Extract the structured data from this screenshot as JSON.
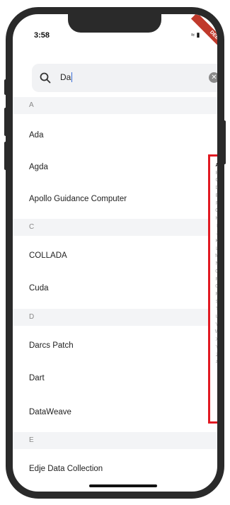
{
  "status": {
    "time": "3:58",
    "debug_label": "DEBUG"
  },
  "search": {
    "value": "Da",
    "clear_icon": "clear-icon",
    "icon": "search-icon"
  },
  "sections": [
    {
      "header": "A",
      "items": [
        "Ada",
        "Agda",
        "Apollo Guidance Computer"
      ]
    },
    {
      "header": "C",
      "items": [
        "COLLADA",
        "Cuda"
      ]
    },
    {
      "header": "D",
      "items": [
        "Darcs Patch",
        "Dart",
        "DataWeave"
      ]
    },
    {
      "header": "E",
      "items": [
        "Edje Data Collection"
      ]
    }
  ],
  "index_letters": [
    "A",
    "B",
    "C",
    "D",
    "E",
    "F",
    "G",
    "H",
    "I",
    "J",
    "K",
    "L",
    "M",
    "N",
    "O",
    "P",
    "Q",
    "R",
    "S",
    "T",
    "U",
    "V",
    "W",
    "X",
    "Y",
    "Z",
    "#"
  ],
  "index_active": "A",
  "colors": {
    "index_highlight": "#e11a22",
    "header_bg": "#f3f4f6",
    "search_bg": "#f1f2f4"
  }
}
